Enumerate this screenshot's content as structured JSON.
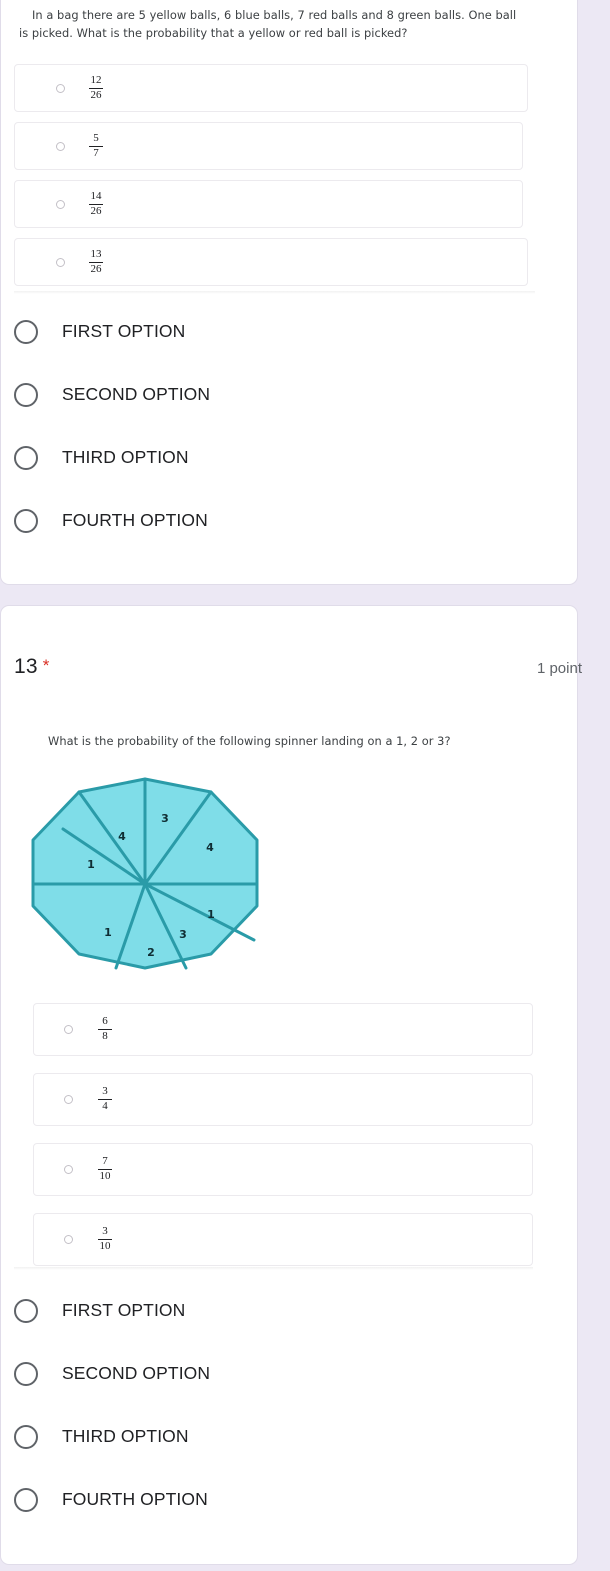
{
  "theme": {
    "page_background": "#ece8f4",
    "card_background": "#ffffff",
    "accent_required": "#d93025",
    "spinner_fill": "#7fdde8",
    "spinner_stroke": "#2a9ba8",
    "text_primary": "#202124",
    "text_secondary": "#5f6368"
  },
  "questions": [
    {
      "id": "q12",
      "image": {
        "prompt_line_1": "In a bag there are 5 yellow balls, 6 blue balls, 7 red balls and 8 green balls. One ball",
        "prompt_line_2": "is picked. What is the probability that a yellow or red ball is picked?",
        "options": [
          {
            "numerator": "12",
            "denominator": "26"
          },
          {
            "numerator": "5",
            "denominator": "7"
          },
          {
            "numerator": "14",
            "denominator": "26"
          },
          {
            "numerator": "13",
            "denominator": "26"
          }
        ]
      },
      "choices": [
        {
          "label": "FIRST OPTION"
        },
        {
          "label": "SECOND OPTION"
        },
        {
          "label": "THIRD OPTION"
        },
        {
          "label": "FOURTH OPTION"
        }
      ]
    },
    {
      "id": "q13",
      "number": "13",
      "required_marker": "*",
      "points": "1 point",
      "image": {
        "prompt": "What is the probability of the following spinner landing on a 1, 2 or 3?",
        "spinner": {
          "shape": "decagon",
          "sector_count": 8,
          "sector_labels": [
            "3",
            "4",
            "1",
            "1",
            "2",
            "3",
            "1",
            "4"
          ]
        },
        "options": [
          {
            "numerator": "6",
            "denominator": "8"
          },
          {
            "numerator": "3",
            "denominator": "4"
          },
          {
            "numerator": "7",
            "denominator": "10"
          },
          {
            "numerator": "3",
            "denominator": "10"
          }
        ]
      },
      "choices": [
        {
          "label": "FIRST OPTION"
        },
        {
          "label": "SECOND OPTION"
        },
        {
          "label": "THIRD OPTION"
        },
        {
          "label": "FOURTH OPTION"
        }
      ]
    }
  ]
}
